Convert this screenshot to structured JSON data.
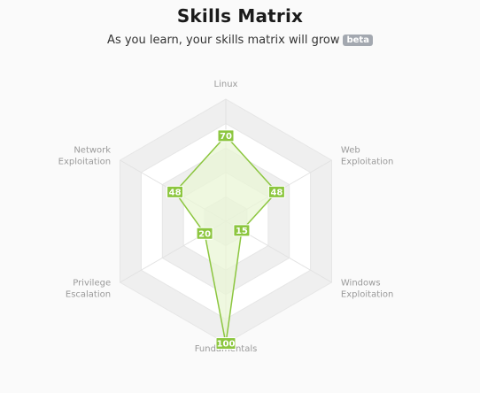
{
  "header": {
    "title": "Skills Matrix",
    "subtitle": "As you learn, your skills matrix will grow",
    "badge": "beta"
  },
  "colors": {
    "accent": "#8cc63f",
    "fill": "#e9f5d5",
    "grid_band": "#efefef",
    "grid_band_alt": "#ffffff",
    "label": "#9a9a9a"
  },
  "chart_data": {
    "type": "radar",
    "title": "Skills Matrix",
    "categories": [
      [
        "Linux"
      ],
      [
        "Web",
        "Exploitation"
      ],
      [
        "Windows",
        "Exploitation"
      ],
      [
        "Fundamentals"
      ],
      [
        "Privilege",
        "Escalation"
      ],
      [
        "Network",
        "Exploitation"
      ]
    ],
    "values": [
      70,
      48,
      15,
      100,
      20,
      48
    ],
    "rlim": [
      0,
      100
    ],
    "grid": true
  }
}
